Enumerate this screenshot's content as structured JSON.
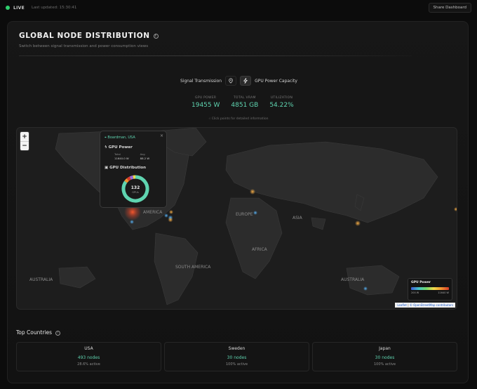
{
  "header": {
    "live_label": "LIVE",
    "updated_label": "Last updated: 15:30:41",
    "share_label": "Share Dashboard"
  },
  "section": {
    "title": "GLOBAL NODE DISTRIBUTION",
    "subtitle": "Switch between signal transmission and power consumption views"
  },
  "toggle": {
    "left_label": "Signal Transmission",
    "right_label": "GPU Power Capacity",
    "active": "power"
  },
  "stats": [
    {
      "label": "GPU POWER",
      "value": "19455 W"
    },
    {
      "label": "TOTAL VRAM",
      "value": "4851 GB"
    },
    {
      "label": "UTILIZATION",
      "value": "54.22%"
    }
  ],
  "hint": "Click points for detailed information",
  "map": {
    "labels": [
      "AMERICA",
      "EUROPE",
      "ASIA",
      "AFRICA",
      "SOUTH AMERICA",
      "AUSTRALIA",
      "AUSTRALIA"
    ],
    "popup": {
      "location": "Boardman, USA",
      "power_title": "GPU Power",
      "total_label": "Total",
      "total_value": "11640.0 W",
      "avg_label": "Avg",
      "avg_value": "88.2 W",
      "dist_title": "GPU Distribution",
      "donut_count": "132",
      "donut_unit": "GPUs",
      "donut_shares": [
        0.85,
        0.04,
        0.04,
        0.04,
        0.03
      ],
      "donut_colors": [
        "#5fd4b0",
        "#f0932f",
        "#d53a2c",
        "#9c6ad6",
        "#f0d94b"
      ]
    },
    "legend": {
      "title": "GPU Power",
      "min": "200 W",
      "max": "11640 W"
    },
    "attribution_leaflet": "Leaflet",
    "attribution_osm": "© OpenStreetMap contributors"
  },
  "top_countries": {
    "title": "Top Countries",
    "items": [
      {
        "country": "USA",
        "nodes": "493 nodes",
        "active": "28.6% active"
      },
      {
        "country": "Sweden",
        "nodes": "30 nodes",
        "active": "100% active"
      },
      {
        "country": "Japan",
        "nodes": "30 nodes",
        "active": "100% active"
      }
    ]
  }
}
